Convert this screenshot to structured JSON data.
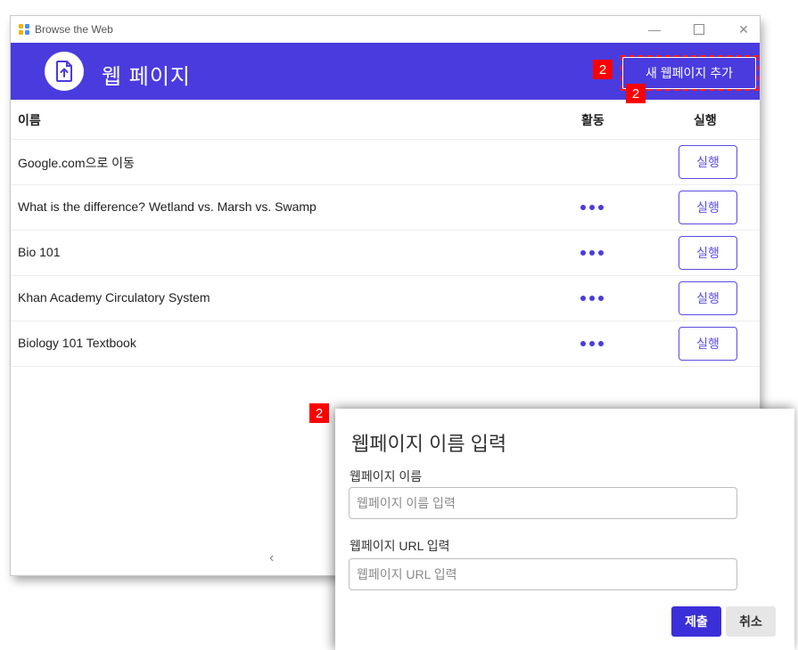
{
  "window": {
    "title": "Browse the Web"
  },
  "header": {
    "title": "웹 페이지",
    "add_button_label": "새 웹페이지 추가"
  },
  "annotations": {
    "badge_add_button": "2",
    "badge_below_button": "2",
    "badge_dialog": "2"
  },
  "table": {
    "columns": {
      "name": "이름",
      "activity": "활동",
      "run": "실행"
    },
    "rows": [
      {
        "name": "Google.com으로 이동",
        "has_activity_menu": false,
        "run_label": "실행"
      },
      {
        "name": "What is the difference? Wetland vs. Marsh vs. Swamp",
        "has_activity_menu": true,
        "run_label": "실행"
      },
      {
        "name": "Bio 101",
        "has_activity_menu": true,
        "run_label": "실행"
      },
      {
        "name": "Khan Academy Circulatory System",
        "has_activity_menu": true,
        "run_label": "실행"
      },
      {
        "name": "Biology 101 Textbook",
        "has_activity_menu": true,
        "run_label": "실행"
      }
    ]
  },
  "pagination": {
    "prev_glyph": "‹"
  },
  "dialog": {
    "title": "웹페이지 이름 입력",
    "name_label": "웹페이지 이름",
    "name_placeholder": "웹페이지 이름 입력",
    "name_value": "",
    "url_label": "웹페이지 URL 입력",
    "url_placeholder": "웹페이지 URL 입력",
    "url_value": "",
    "submit_label": "제출",
    "cancel_label": "취소"
  },
  "colors": {
    "accent": "#4a3bdf",
    "highlight": "#ff0000"
  },
  "icons": {
    "app": "app-grid-icon",
    "logo": "upload-document-icon",
    "activity": "more-dots-icon"
  }
}
